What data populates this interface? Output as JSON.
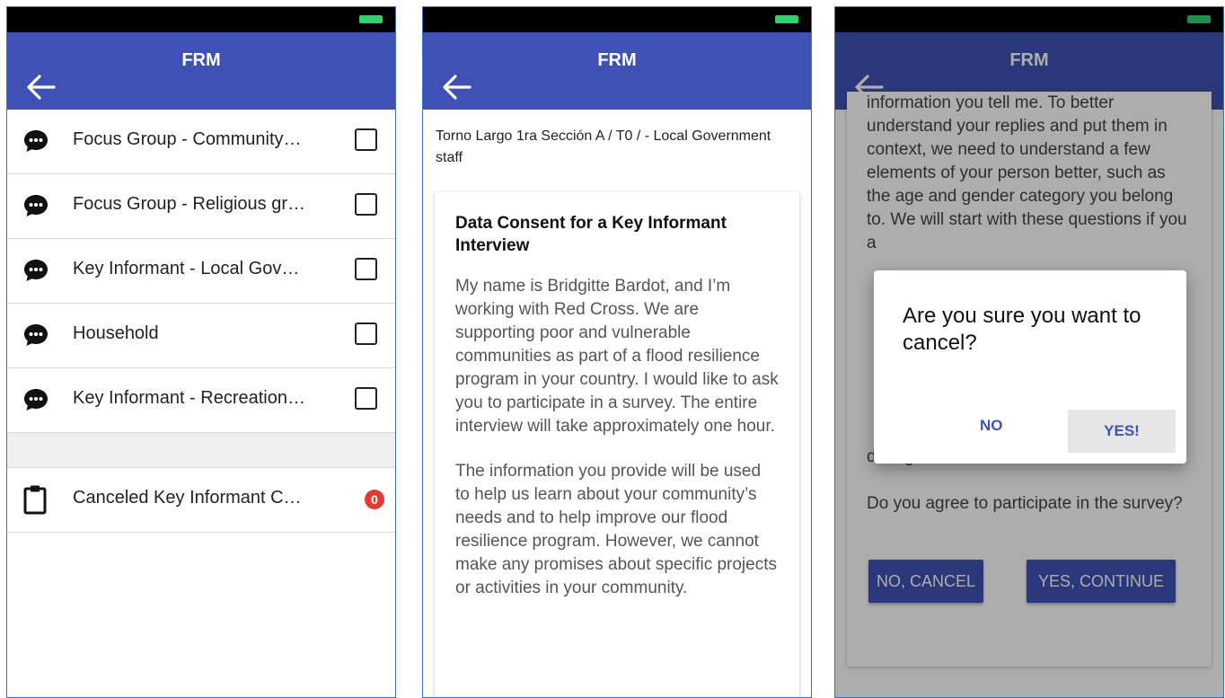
{
  "app": {
    "title": "FRM"
  },
  "screen1": {
    "items": [
      {
        "label": "Focus Group - Community…"
      },
      {
        "label": "Focus Group - Religious gr…"
      },
      {
        "label": "Key Informant - Local Gov…"
      },
      {
        "label": "Household"
      },
      {
        "label": "Key Informant - Recreation…"
      }
    ],
    "canceled": {
      "label": "Canceled Key Informant C…",
      "count": "0"
    }
  },
  "screen2": {
    "location": "Torno Largo 1ra Sección A / T0 / - Local Government staff",
    "heading": "Data Consent for a Key Informant Interview",
    "paragraph1": "My name is Bridgitte Bardot, and I’m working with Red Cross. We are supporting poor and vulnerable communities as part of a flood resilience program in your country. I would like to ask you to participate in a survey. The entire interview will take approximately one hour.",
    "paragraph2": "The information you provide will be used to help us learn about your community’s needs and to help improve our flood resilience program. However, we cannot make any promises about specific projects or activities in your community."
  },
  "screen3": {
    "text_top": "information you tell me. To better understand your replies and put them in context, we need to understand a few elements of your person better, such as the age and gender category you belong to. We will start with these questions if you a",
    "text_mid": "during the interview.",
    "question": "Do you agree to participate in the survey?",
    "no_cancel_label": "NO, CANCEL",
    "yes_continue_label": "YES, CONTINUE",
    "dialog": {
      "question": "Are you sure you want to cancel?",
      "no_label": "NO",
      "yes_label": "YES!"
    }
  },
  "colors": {
    "appbar": "#3f51b5",
    "badge": "#e53935",
    "status_battery": "#2fd56b"
  }
}
